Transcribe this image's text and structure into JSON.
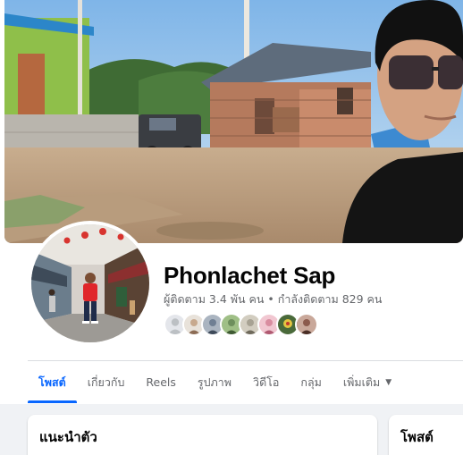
{
  "profile": {
    "name": "Phonlachet Sap",
    "followers": "ผู้ติดตาม 3.4 พัน คน",
    "separator": "•",
    "following": "กำลังติดตาม 829 คน"
  },
  "friends_preview": [
    {
      "icon": "default-avatar-icon",
      "color": "#bcc0c4"
    },
    {
      "icon": "friend-avatar-icon",
      "color": "#c7a98e"
    },
    {
      "icon": "friend-avatar-icon",
      "color": "#6f7f93"
    },
    {
      "icon": "friend-avatar-icon",
      "color": "#6e8f5d"
    },
    {
      "icon": "friend-avatar-icon",
      "color": "#a7a293"
    },
    {
      "icon": "friend-avatar-icon",
      "color": "#d98da0"
    },
    {
      "icon": "friend-avatar-icon",
      "color": "#e3c541"
    },
    {
      "icon": "friend-avatar-icon",
      "color": "#8b5a4c"
    }
  ],
  "tabs": [
    {
      "label": "โพสต์",
      "active": true
    },
    {
      "label": "เกี่ยวกับ",
      "active": false
    },
    {
      "label": "Reels",
      "active": false
    },
    {
      "label": "รูปภาพ",
      "active": false
    },
    {
      "label": "วิดีโอ",
      "active": false
    },
    {
      "label": "กลุ่ม",
      "active": false
    },
    {
      "label": "เพิ่มเติม",
      "active": false,
      "dropdown_icon": "caret-down-icon"
    }
  ],
  "cards": {
    "intro_title": "แนะนำตัว",
    "posts_title": "โพสต์"
  },
  "colors": {
    "accent": "#0866ff",
    "secondary_text": "#65676b",
    "feed_background": "#f0f2f5"
  }
}
